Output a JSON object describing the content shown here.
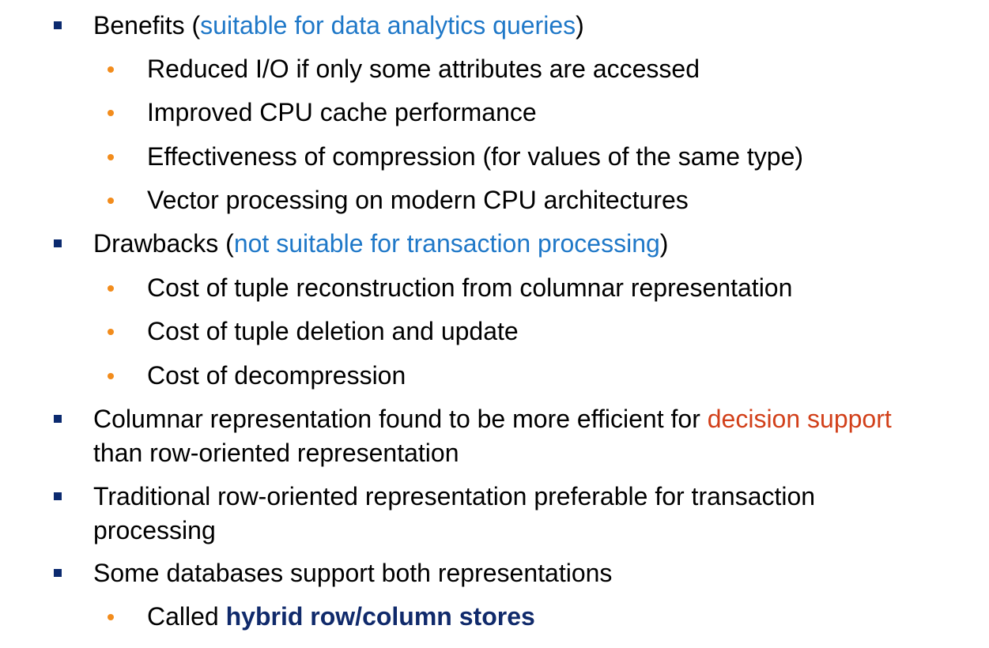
{
  "accent_colors": {
    "level1_marker": "#0b2a6f",
    "level2_marker": "#f28c1c",
    "highlight_blue": "#1f78c8",
    "highlight_red": "#d2401a",
    "emphasis_navy": "#102a6b"
  },
  "items": [
    {
      "pre": "Benefits (",
      "highlight": "suitable for data analytics queries",
      "post": ")"
    },
    {
      "text": "Reduced I/O if only some attributes are accessed"
    },
    {
      "text": "Improved CPU cache performance"
    },
    {
      "text": "Effectiveness of compression (for values of the same type)"
    },
    {
      "text": "Vector processing on modern CPU architectures"
    },
    {
      "pre": "Drawbacks (",
      "highlight": "not suitable for transaction processing",
      "post": ")"
    },
    {
      "text": "Cost of tuple reconstruction from columnar representation"
    },
    {
      "text": "Cost of tuple deletion and update"
    },
    {
      "text": "Cost of decompression"
    },
    {
      "pre": "Columnar representation found to be more efficient for ",
      "highlight": "decision support",
      "line2": "than row-oriented representation"
    },
    {
      "text": "Traditional row-oriented representation preferable for transaction",
      "line2": "processing"
    },
    {
      "text": "Some databases support both representations"
    },
    {
      "pre": "Called ",
      "bold": "hybrid row/column stores"
    }
  ]
}
